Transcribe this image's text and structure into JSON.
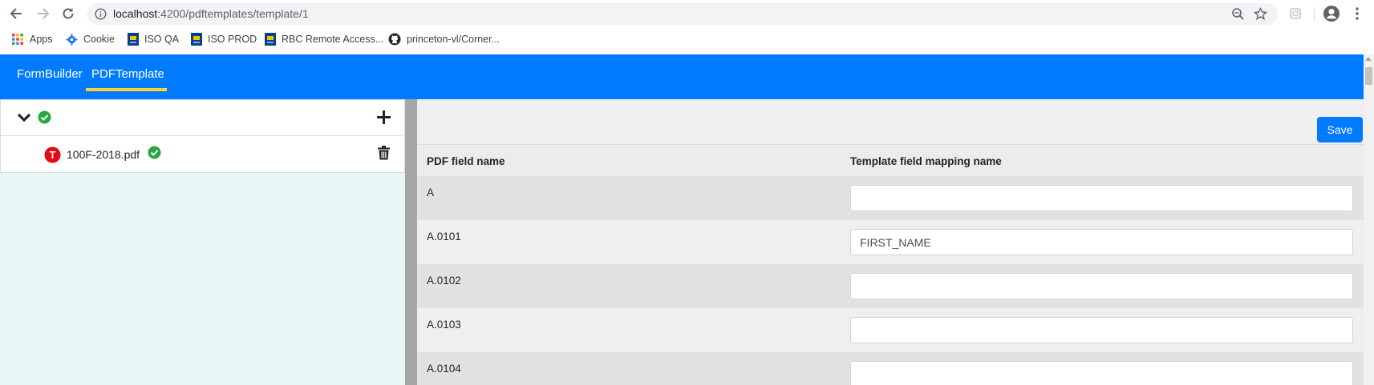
{
  "browser": {
    "url_host": "localhost",
    "url_path": ":4200/pdftemplates/template/1",
    "icons": [
      "back-icon",
      "forward-icon",
      "reload-icon",
      "info-icon",
      "zoom-icon",
      "star-icon",
      "extension-icon",
      "profile-icon",
      "menu-icon"
    ]
  },
  "bookmarks": {
    "items": [
      {
        "label": "Apps",
        "icon": "apps-grid-icon"
      },
      {
        "label": "Cookie",
        "icon": "gear-icon"
      },
      {
        "label": "ISO QA",
        "icon": "bank-icon"
      },
      {
        "label": "ISO PROD",
        "icon": "bank-icon"
      },
      {
        "label": "RBC Remote Access...",
        "icon": "bank-icon"
      },
      {
        "label": "princeton-vl/Corner...",
        "icon": "github-icon"
      }
    ]
  },
  "header": {
    "tabs": [
      {
        "label": "FormBuilder",
        "active": false
      },
      {
        "label": "PDFTemplate",
        "active": true
      }
    ],
    "color": "#007bff",
    "underline_color": "#ffd22e"
  },
  "tree": {
    "root_icons": [
      "chevron-down-icon",
      "check-circle-icon",
      "plus-icon"
    ],
    "file": {
      "badge": "T",
      "name": "100F-2018.pdf",
      "icons": [
        "check-circle-icon",
        "trash-icon"
      ]
    }
  },
  "table": {
    "save_label": "Save",
    "columns": [
      "PDF field name",
      "Template field mapping name"
    ],
    "rows": [
      {
        "name": "A",
        "value": ""
      },
      {
        "name": "A.0101",
        "value": "FIRST_NAME"
      },
      {
        "name": "A.0102",
        "value": ""
      },
      {
        "name": "A.0103",
        "value": ""
      },
      {
        "name": "A.0104",
        "value": ""
      }
    ]
  }
}
